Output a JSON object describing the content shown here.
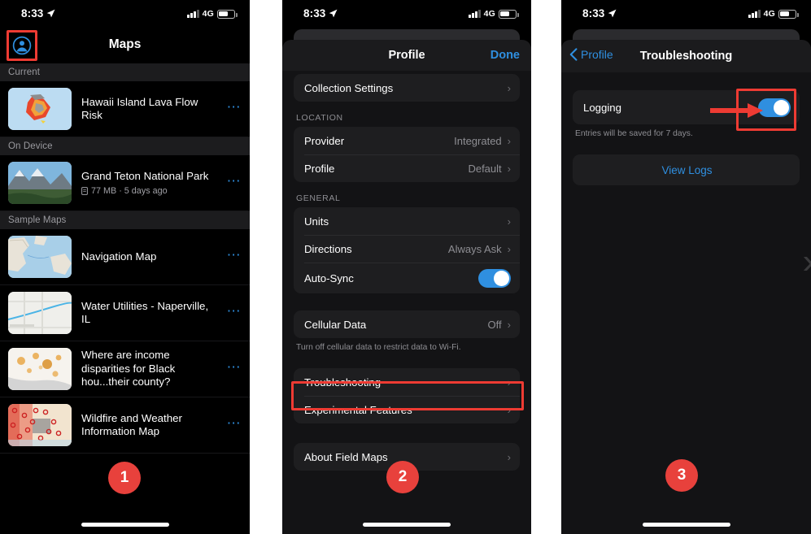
{
  "statusbar": {
    "time": "8:33",
    "network": "4G",
    "location_icon": "location-arrow-icon",
    "signal_icon": "cellular-bars-icon",
    "battery_icon": "battery-icon"
  },
  "panel1": {
    "step": "1",
    "nav": {
      "title": "Maps",
      "avatar_icon": "account-circle-icon",
      "highlighted": true
    },
    "sections": [
      {
        "header": "Current",
        "rows": [
          {
            "title": "Hawaii Island Lava Flow Risk",
            "subtitle": "",
            "menu_icon": "more-options-icon",
            "thumb": "hawaii-lava-thumbnail"
          }
        ]
      },
      {
        "header": "On Device",
        "rows": [
          {
            "title": "Grand Teton National Park",
            "subtitle": "77 MB · 5 days ago",
            "menu_icon": "more-options-icon",
            "thumb": "grand-teton-thumbnail"
          }
        ]
      },
      {
        "header": "Sample Maps",
        "rows": [
          {
            "title": "Navigation Map",
            "subtitle": "",
            "menu_icon": "more-options-icon",
            "thumb": "navigation-map-thumbnail"
          },
          {
            "title": "Water Utilities - Naperville, IL",
            "subtitle": "",
            "menu_icon": "more-options-icon",
            "thumb": "water-utilities-thumbnail"
          },
          {
            "title": "Where are income disparities for Black hou...their county?",
            "subtitle": "",
            "menu_icon": "more-options-icon",
            "thumb": "income-disparities-thumbnail"
          },
          {
            "title": "Wildfire and Weather Information Map",
            "subtitle": "",
            "menu_icon": "more-options-icon",
            "thumb": "wildfire-weather-thumbnail"
          }
        ]
      }
    ]
  },
  "panel2": {
    "step": "2",
    "header": {
      "title": "Profile",
      "done_label": "Done"
    },
    "collection": {
      "label": "Collection Settings",
      "chevron": "chevron-right-icon"
    },
    "location": {
      "label": "LOCATION",
      "rows": [
        {
          "label": "Provider",
          "value": "Integrated",
          "chevron": "chevron-right-icon"
        },
        {
          "label": "Profile",
          "value": "Default",
          "chevron": "chevron-right-icon"
        }
      ]
    },
    "general": {
      "label": "GENERAL",
      "rows": [
        {
          "label": "Units",
          "value": "",
          "chevron": "chevron-right-icon"
        },
        {
          "label": "Directions",
          "value": "Always Ask",
          "chevron": "chevron-right-icon"
        }
      ],
      "autosync": {
        "label": "Auto-Sync",
        "enabled": true
      }
    },
    "cellular": {
      "label": "Cellular Data",
      "value": "Off",
      "chevron": "chevron-right-icon",
      "footnote": "Turn off cellular data to restrict data to Wi-Fi."
    },
    "support": {
      "troubleshooting": {
        "label": "Troubleshooting",
        "chevron": "chevron-right-icon",
        "highlighted": true
      },
      "experimental": {
        "label": "Experimental Features",
        "chevron": "chevron-right-icon"
      }
    },
    "about": {
      "label": "About Field Maps",
      "chevron": "chevron-right-icon"
    }
  },
  "panel3": {
    "step": "3",
    "header": {
      "back_label": "Profile",
      "back_icon": "chevron-left-icon",
      "title": "Troubleshooting"
    },
    "logging": {
      "label": "Logging",
      "enabled": true,
      "highlighted": true,
      "arrow_icon": "red-arrow-right-icon"
    },
    "footnote": "Entries will be saved for 7 days.",
    "view_logs": {
      "label": "View Logs"
    },
    "edge_chevron_icon": "chevron-right-icon"
  },
  "colors": {
    "accent_blue": "#2f8fe0",
    "highlight_red": "#ee3b33",
    "badge_red": "#e8413c",
    "toggle_on": "#2f8fe0"
  }
}
